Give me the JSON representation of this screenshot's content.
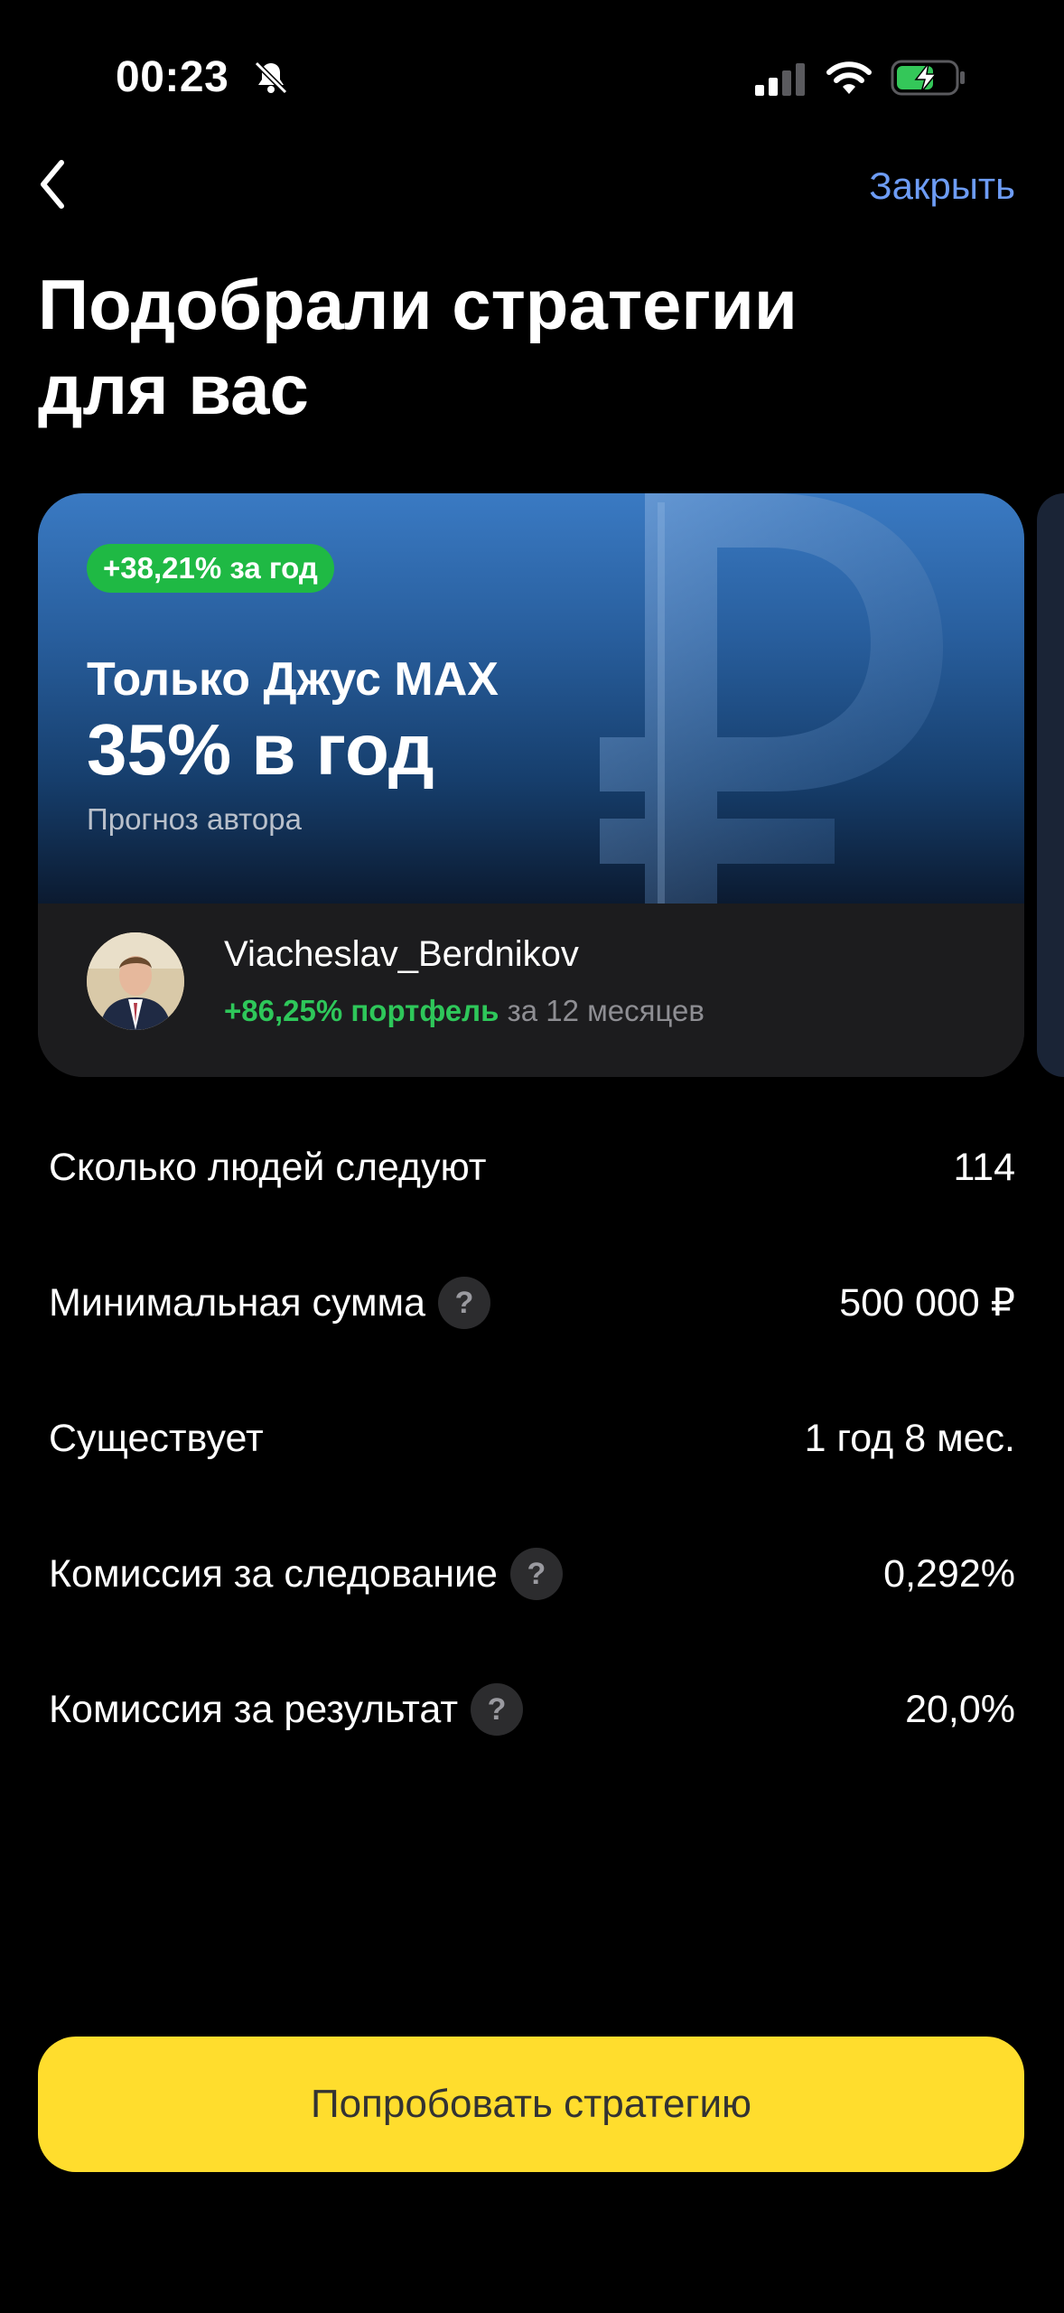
{
  "status_bar": {
    "time": "00:23",
    "icons": [
      "bell-slash-icon",
      "signal-icon",
      "wifi-icon",
      "battery-charging-icon"
    ]
  },
  "nav": {
    "back_icon": "chevron-left-icon",
    "close_label": "Закрыть"
  },
  "page": {
    "title_line1": "Подобрали стратегии",
    "title_line2": "для вас"
  },
  "strategy_card": {
    "return_badge": "+38,21% за год",
    "name": "Только Джус MAX",
    "forecast": "35% в год",
    "forecast_caption": "Прогноз автора",
    "author": {
      "name": "Viacheslav_Berdnikov",
      "portfolio_return": "+86,25% портфель",
      "period": "за 12 месяцев"
    }
  },
  "details": [
    {
      "label": "Сколько людей следуют",
      "value": "114",
      "has_help": false
    },
    {
      "label": "Минимальная сумма",
      "value": "500 000 ₽",
      "has_help": true
    },
    {
      "label": "Существует",
      "value": "1 год 8 мес.",
      "has_help": false
    },
    {
      "label": "Комиссия за следование",
      "value": "0,292%",
      "has_help": true
    },
    {
      "label": "Комиссия за результат",
      "value": "20,0%",
      "has_help": true
    }
  ],
  "help_glyph": "?",
  "cta": {
    "label": "Попробовать стратегию"
  },
  "colors": {
    "background": "#000000",
    "accent_link": "#6d9cf5",
    "badge_green": "#1fb944",
    "positive_text": "#2ec75a",
    "cta_yellow": "#ffdd2d",
    "card_surface": "#1c1c1e"
  }
}
